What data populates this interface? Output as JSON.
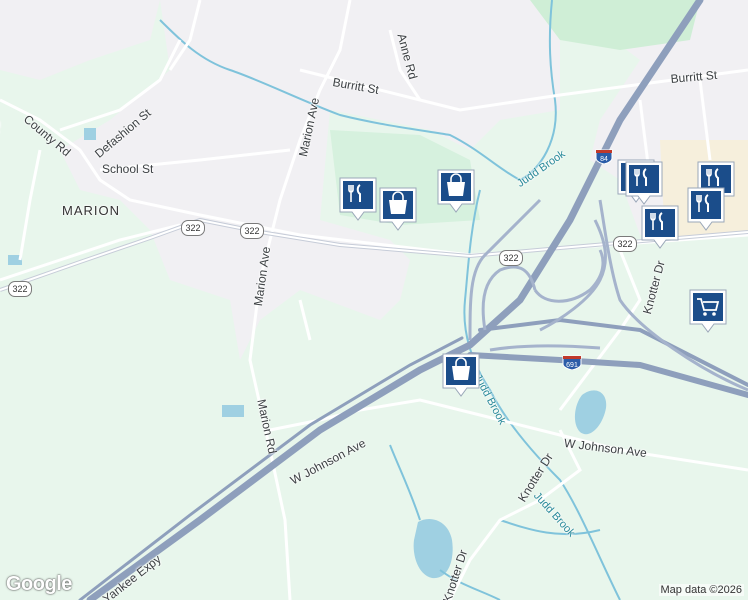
{
  "map": {
    "roads": {
      "county_rd": "County Rd",
      "defashion_st": "Defashion St",
      "school_st": "School St",
      "marion_ave_upper": "Marion Ave",
      "marion_ave_lower": "Marion Ave",
      "marion_rd": "Marion Rd",
      "anne_rd": "Anne Rd",
      "burritt_st_left": "Burritt St",
      "burritt_st_right": "Burritt St",
      "knotter_dr_upper": "Knotter Dr",
      "knotter_dr_mid": "Knotter Dr",
      "knotter_dr_lower": "Knotter Dr",
      "w_johnson_ave_left": "W Johnson Ave",
      "w_johnson_ave_right": "W Johnson Ave",
      "yankee_expy": "Yankee Expy",
      "edge_left": "Dr"
    },
    "places": {
      "marion": "MARION"
    },
    "water": {
      "judd_brook_1": "Judd Brook",
      "judd_brook_2": "Judd Brook",
      "judd_brook_3": "Judd Brook"
    },
    "shields": {
      "rt322_a": "322",
      "rt322_b": "322",
      "rt322_c": "322",
      "rt322_d": "322",
      "rt322_e": "322",
      "i84": "84",
      "i691": "691"
    },
    "markers": [
      {
        "type": "restaurant",
        "icon": "fork-knife-icon"
      },
      {
        "type": "shopping",
        "icon": "shopping-bag-icon"
      },
      {
        "type": "shopping",
        "icon": "shopping-bag-icon"
      },
      {
        "type": "restaurant",
        "icon": "fork-knife-icon"
      },
      {
        "type": "restaurant",
        "icon": "fork-knife-icon"
      },
      {
        "type": "restaurant",
        "icon": "fork-knife-icon"
      },
      {
        "type": "restaurant",
        "icon": "fork-knife-icon"
      },
      {
        "type": "restaurant",
        "icon": "fork-knife-icon"
      },
      {
        "type": "grocery",
        "icon": "shopping-cart-icon"
      },
      {
        "type": "shopping",
        "icon": "shopping-bag-icon"
      }
    ],
    "colors": {
      "land": "#e8f6ec",
      "urban": "#f2f1f3",
      "highway": "#8e9fbc",
      "water": "#9fd0e2",
      "marker": "#1b4d8a"
    }
  },
  "branding": {
    "logo": "Google",
    "attribution": "Map data ©2026"
  }
}
